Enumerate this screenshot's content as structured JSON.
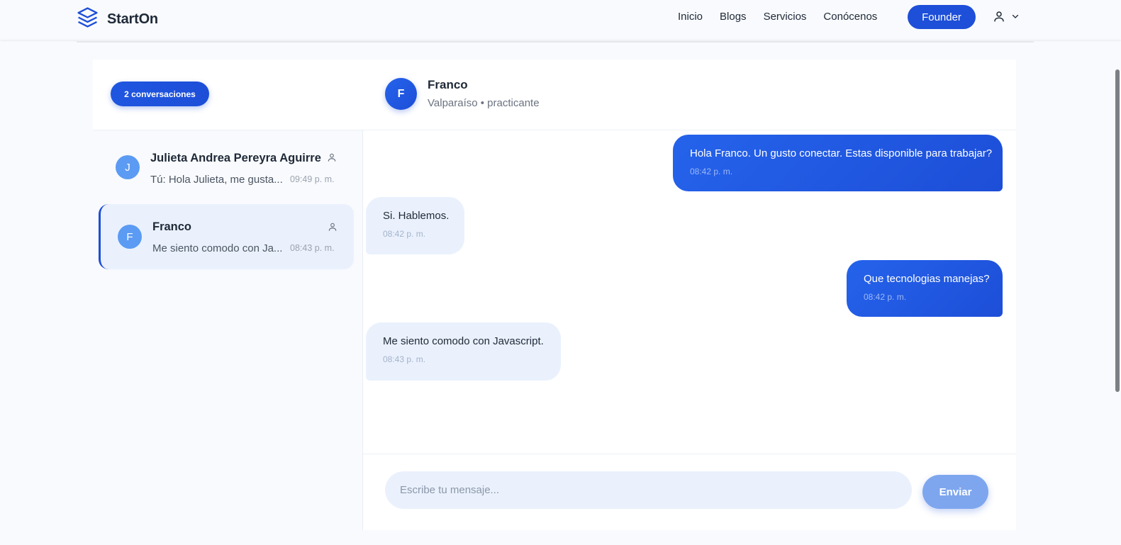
{
  "brand": {
    "name": "StartOn",
    "accent": "#1d4ed8"
  },
  "nav": {
    "items": [
      "Inicio",
      "Blogs",
      "Servicios",
      "Conócenos"
    ],
    "founder_label": "Founder"
  },
  "sidebar": {
    "badge": "2 conversaciones",
    "conversations": [
      {
        "initial": "J",
        "name": "Julieta Andrea Pereyra Aguirre",
        "preview": "Tú: Hola Julieta, me gusta...",
        "time": "09:49 p. m.",
        "active": false
      },
      {
        "initial": "F",
        "name": "Franco",
        "preview": "Me siento comodo con Ja...",
        "time": "08:43 p. m.",
        "active": true
      }
    ]
  },
  "chat": {
    "initial": "F",
    "name": "Franco",
    "subtitle": "Valparaíso • practicante",
    "messages": [
      {
        "direction": "out",
        "text": "Hola Franco. Un gusto conectar. Estas disponible para trabajar?",
        "time": "08:42 p. m."
      },
      {
        "direction": "in",
        "text": "Si. Hablemos.",
        "time": "08:42 p. m."
      },
      {
        "direction": "out",
        "text": "Que tecnologias manejas?",
        "time": "08:42 p. m."
      },
      {
        "direction": "in",
        "text": "Me siento comodo con Javascript.",
        "time": "08:43 p. m."
      }
    ],
    "composer": {
      "placeholder": "Escribe tu mensaje...",
      "value": "",
      "send_label": "Enviar"
    }
  }
}
